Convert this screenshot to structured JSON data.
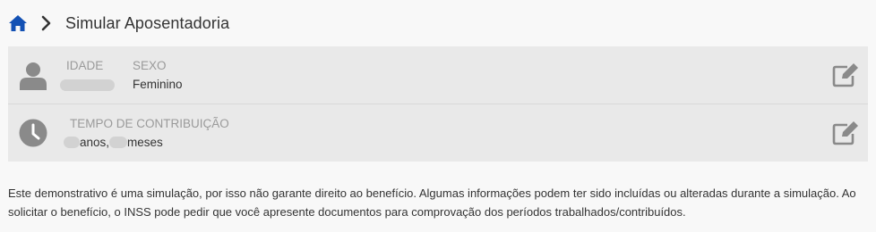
{
  "breadcrumb": {
    "home_icon": "home-icon",
    "separator_icon": "chevron-right-icon",
    "title": "Simular Aposentadoria"
  },
  "profile_card": {
    "icon": "person-icon",
    "age_label": "IDADE",
    "sex_label": "SEXO",
    "sex_value": "Feminino",
    "edit_icon": "edit-icon"
  },
  "contribution_card": {
    "icon": "clock-icon",
    "label": "TEMPO DE CONTRIBUIÇÃO",
    "years_unit": "anos,",
    "months_unit": "meses",
    "edit_icon": "edit-icon"
  },
  "disclaimer": "Este demonstrativo é uma simulação, por isso não garante direito ao benefício. Algumas informações podem ter sido incluídas ou alteradas durante a simulação. Ao solicitar o benefício, o INSS pode pedir que você apresente documentos para comprovação dos períodos trabalhados/contribuídos.",
  "colors": {
    "accent": "#1351b4",
    "icon_gray": "#8a8a8a",
    "card_bg": "#e9e9e9",
    "page_bg": "#f8f8f8"
  }
}
